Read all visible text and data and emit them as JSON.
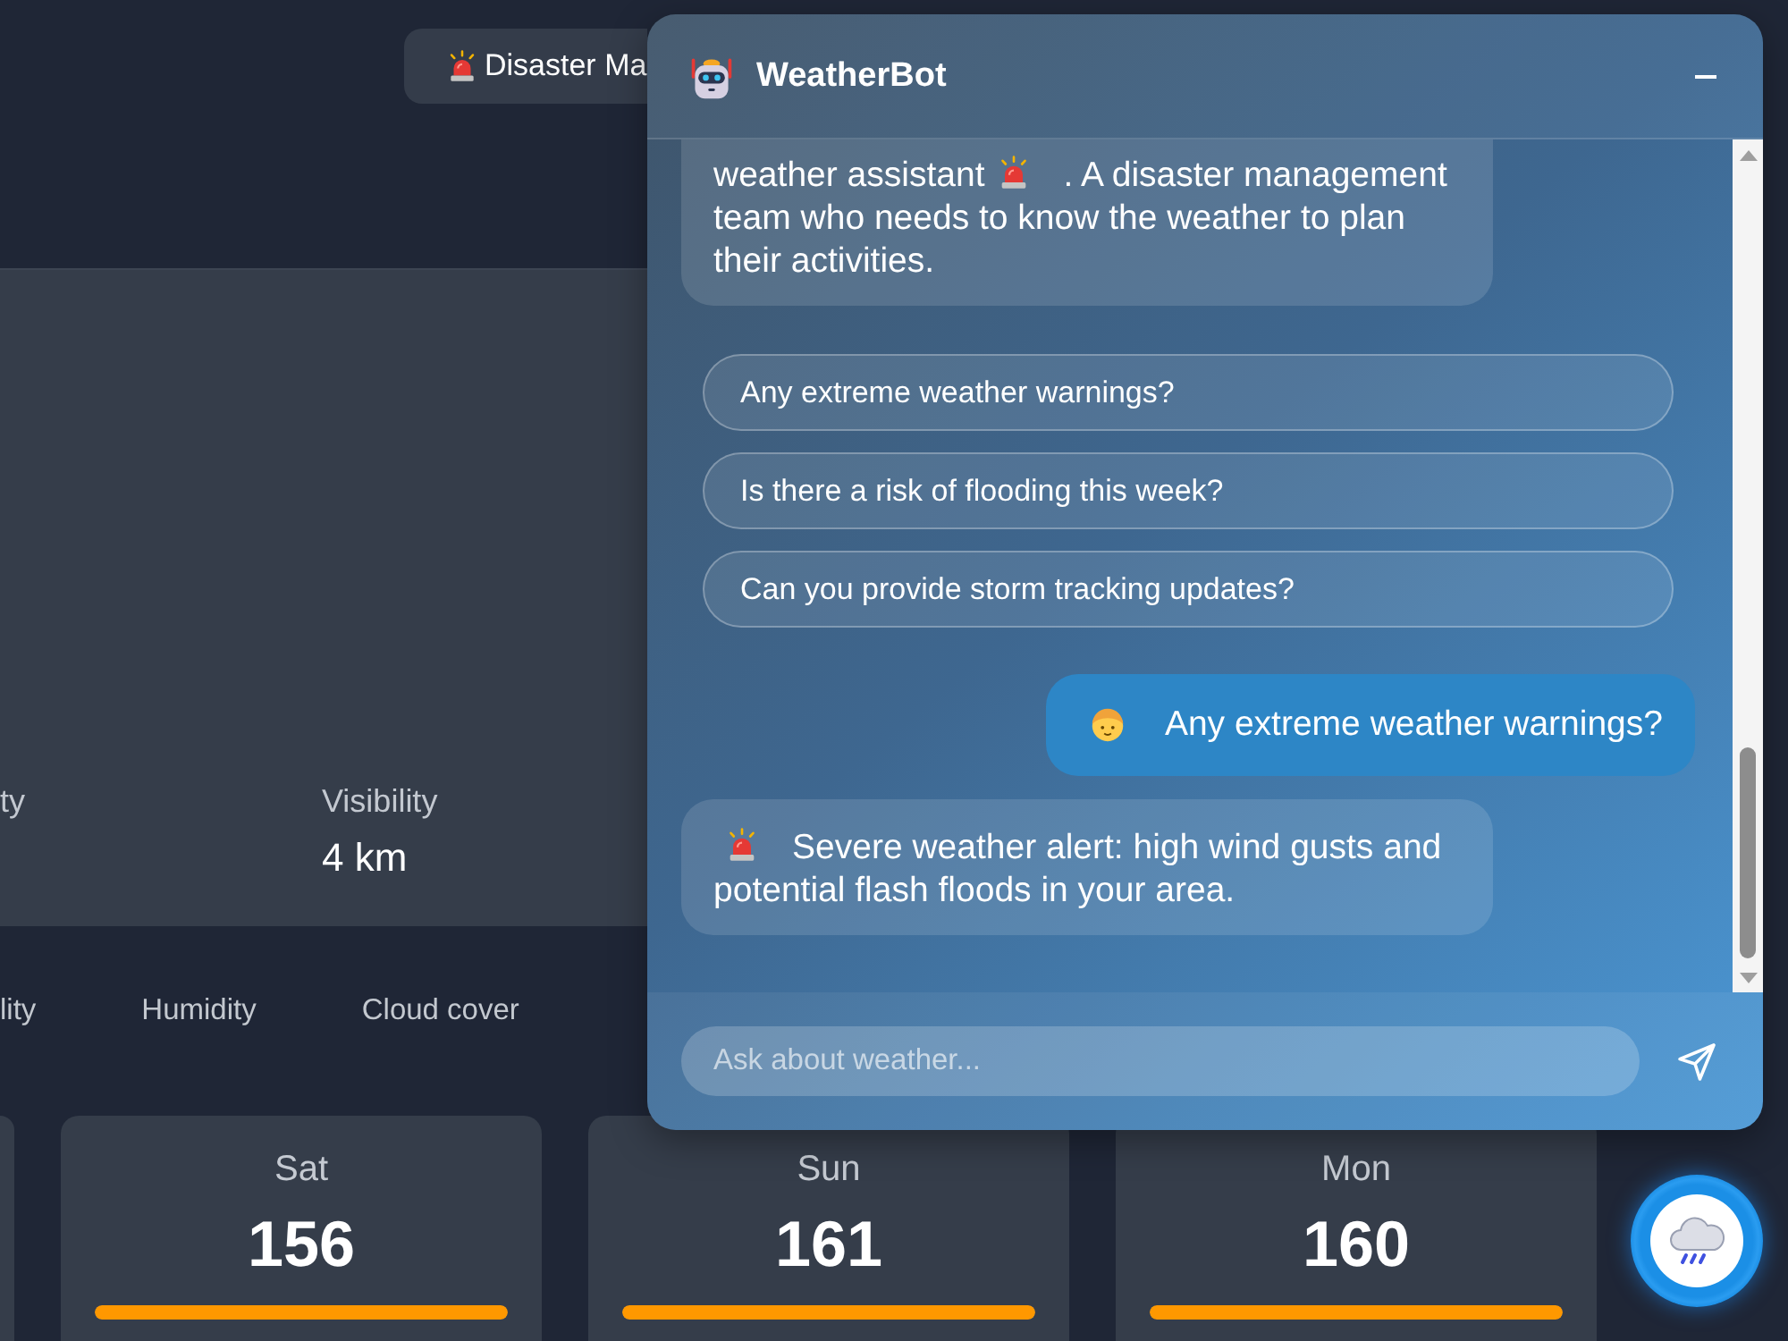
{
  "top_bar": {
    "alert_button": {
      "label": "Disaster Ma"
    }
  },
  "summary_card": {
    "stats": [
      {
        "label": "ty"
      },
      {
        "label": "Visibility",
        "value": "4 km"
      }
    ]
  },
  "metric_tabs": [
    "lity",
    "Humidity",
    "Cloud cover"
  ],
  "forecast": [
    {
      "day": "Sat",
      "value": "156",
      "level": 1
    },
    {
      "day": "Sun",
      "value": "161",
      "level": 1
    },
    {
      "day": "Mon",
      "value": "160",
      "level": 1
    }
  ],
  "chat": {
    "title": "WeatherBot",
    "thread": [
      {
        "kind": "bot",
        "parts": [
          {
            "kind": "text",
            "text": "weather assistant"
          },
          {
            "kind": "icon"
          },
          {
            "kind": "text",
            "text": ". A disaster management team who needs to know the weather to plan their activities."
          }
        ]
      },
      {
        "kind": "suggestions",
        "items": [
          "Any extreme weather warnings?",
          "Is there a risk of flooding this week?",
          "Can you provide storm tracking updates?"
        ]
      },
      {
        "kind": "user",
        "parts": [
          {
            "kind": "icon"
          },
          {
            "kind": "text",
            "text": "Any extreme weather warnings?"
          }
        ]
      },
      {
        "kind": "bot",
        "parts": [
          {
            "kind": "icon"
          },
          {
            "kind": "text",
            "text": "Severe weather alert: high wind gusts and potential flash floods in your area."
          }
        ]
      }
    ],
    "input": {
      "placeholder": "Ask about weather..."
    }
  }
}
